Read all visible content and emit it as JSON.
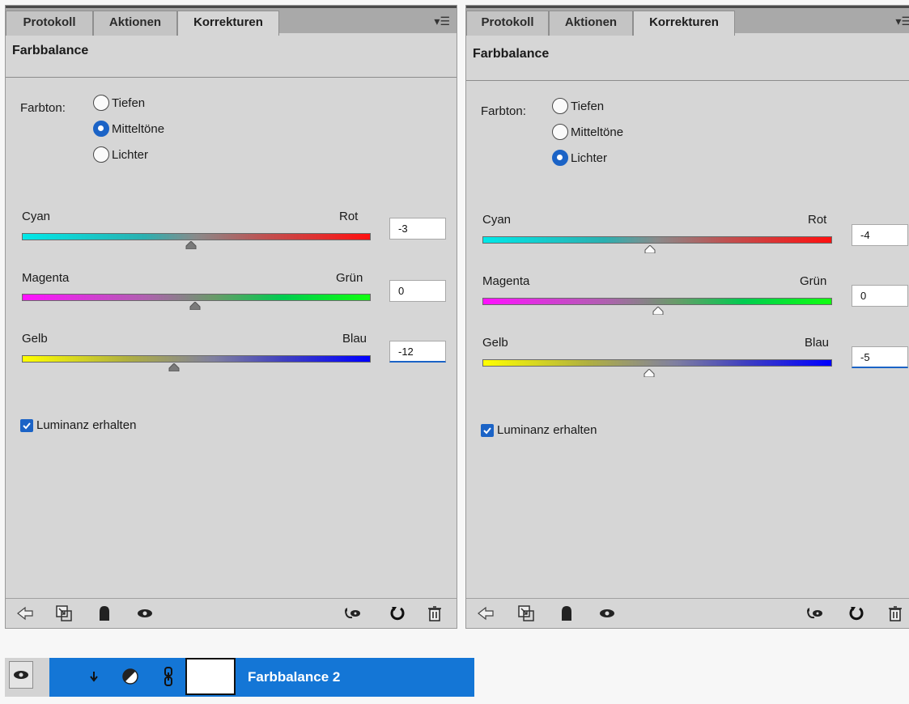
{
  "panels": [
    {
      "tabs": [
        "Protokoll",
        "Aktionen",
        "Korrekturen"
      ],
      "active_tab": 2,
      "title": "Farbbalance",
      "farbton_label": "Farbton:",
      "tones": [
        "Tiefen",
        "Mitteltöne",
        "Lichter"
      ],
      "selected_tone": "Mitteltöne",
      "sliders": [
        {
          "left": "Cyan",
          "right": "Rot",
          "value": "-3"
        },
        {
          "left": "Magenta",
          "right": "Grün",
          "value": "0"
        },
        {
          "left": "Gelb",
          "right": "Blau",
          "value": "-12"
        }
      ],
      "luminanz_label": "Luminanz erhalten",
      "luminanz_checked": true
    },
    {
      "tabs": [
        "Protokoll",
        "Aktionen",
        "Korrekturen"
      ],
      "active_tab": 2,
      "title": "Farbbalance",
      "farbton_label": "Farbton:",
      "tones": [
        "Tiefen",
        "Mitteltöne",
        "Lichter"
      ],
      "selected_tone": "Lichter",
      "sliders": [
        {
          "left": "Cyan",
          "right": "Rot",
          "value": "-4"
        },
        {
          "left": "Magenta",
          "right": "Grün",
          "value": "0"
        },
        {
          "left": "Gelb",
          "right": "Blau",
          "value": "-5"
        }
      ],
      "luminanz_label": "Luminanz erhalten",
      "luminanz_checked": true
    }
  ],
  "panel_menu_icon": "panel-menu-icon",
  "bottom_icons_left": [
    "back-arrow-icon",
    "clip-to-layer-icon",
    "mask-icon",
    "eye-icon"
  ],
  "bottom_icons_right": [
    "view-previous-icon",
    "reset-icon",
    "trash-icon"
  ],
  "layer": {
    "name": "Farbbalance 2",
    "selected_color": "#1476d6"
  },
  "colors": {
    "accent": "#1b63c6",
    "panel_bg": "#d6d6d6",
    "tab_bar": "#a9a9a9"
  }
}
